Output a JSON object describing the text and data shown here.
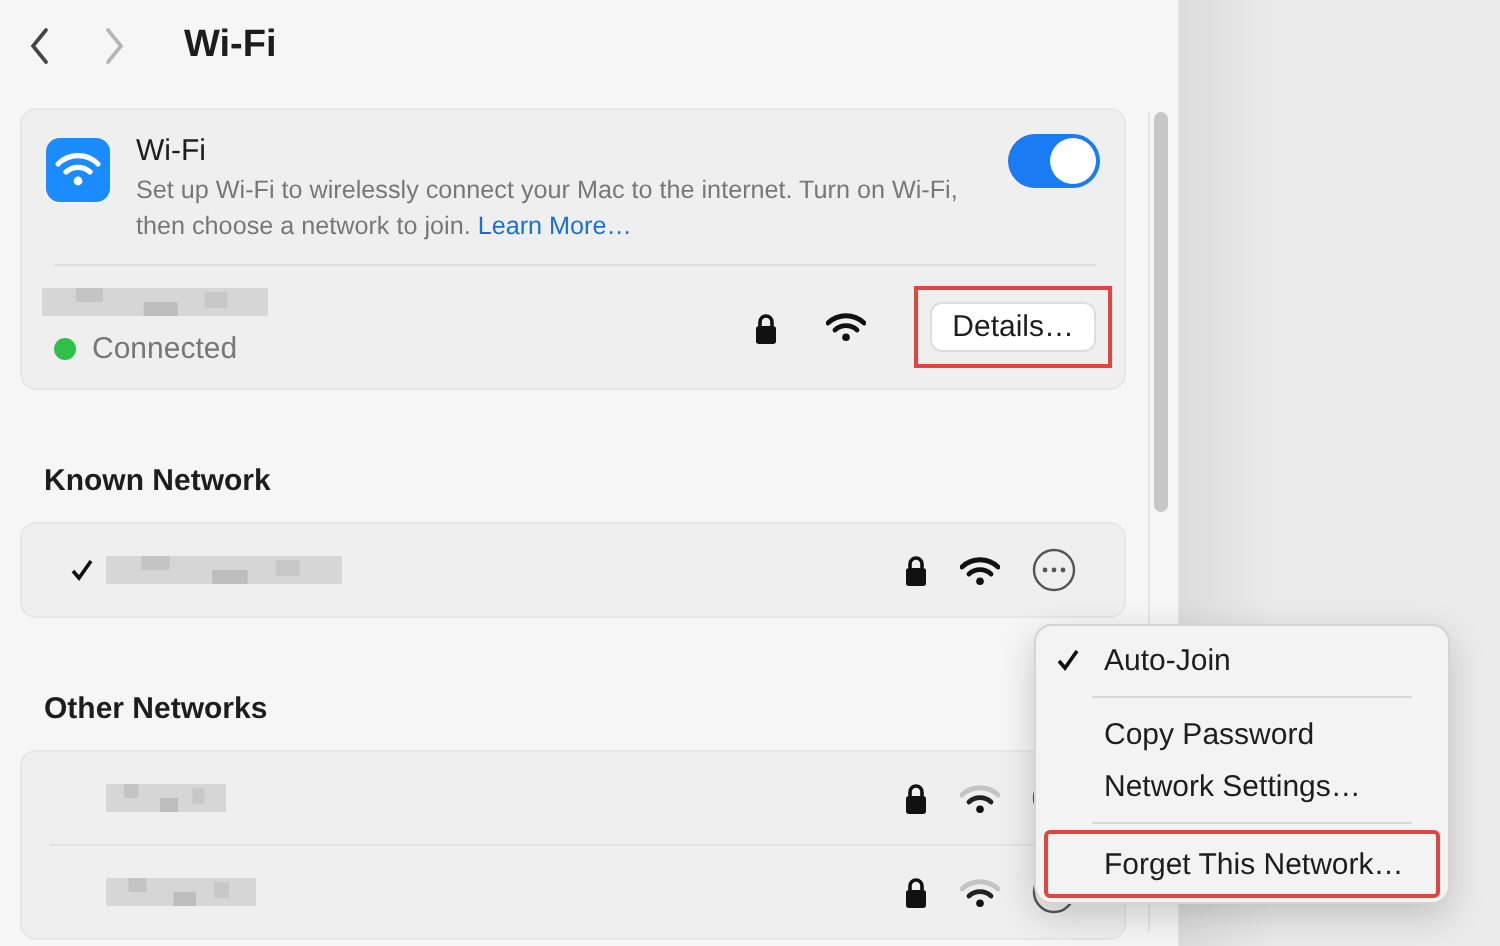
{
  "header": {
    "back": {
      "disabled": false
    },
    "forward": {
      "disabled": true
    },
    "title": "Wi-Fi"
  },
  "wifi_card": {
    "title": "Wi-Fi",
    "description": "Set up Wi-Fi to wirelessly connect your Mac to the internet. Turn on Wi-Fi, then choose a network to join. ",
    "link": "Learn More…",
    "on": true,
    "current": {
      "status": "Connected",
      "secured": true,
      "weak_signal": false,
      "button": {
        "label": "Details…",
        "highlighted": true
      }
    }
  },
  "known_section": {
    "title": "Known Network",
    "networks": [
      {
        "checked": true,
        "secured": true,
        "weak_signal": false
      }
    ]
  },
  "other_section": {
    "title": "Other Networks",
    "networks": [
      {
        "secured": true,
        "weak_signal": true
      },
      {
        "secured": true,
        "weak_signal": true
      }
    ]
  },
  "menu": {
    "items": [
      {
        "kind": "check",
        "label": "Auto-Join",
        "checked": true,
        "highlighted": false
      },
      {
        "kind": "separator"
      },
      {
        "kind": "item",
        "label": "Copy Password",
        "highlighted": false
      },
      {
        "kind": "item",
        "label": "Network Settings…",
        "highlighted": false
      },
      {
        "kind": "separator"
      },
      {
        "kind": "item",
        "label": "Forget This Network…",
        "highlighted": true
      }
    ]
  }
}
